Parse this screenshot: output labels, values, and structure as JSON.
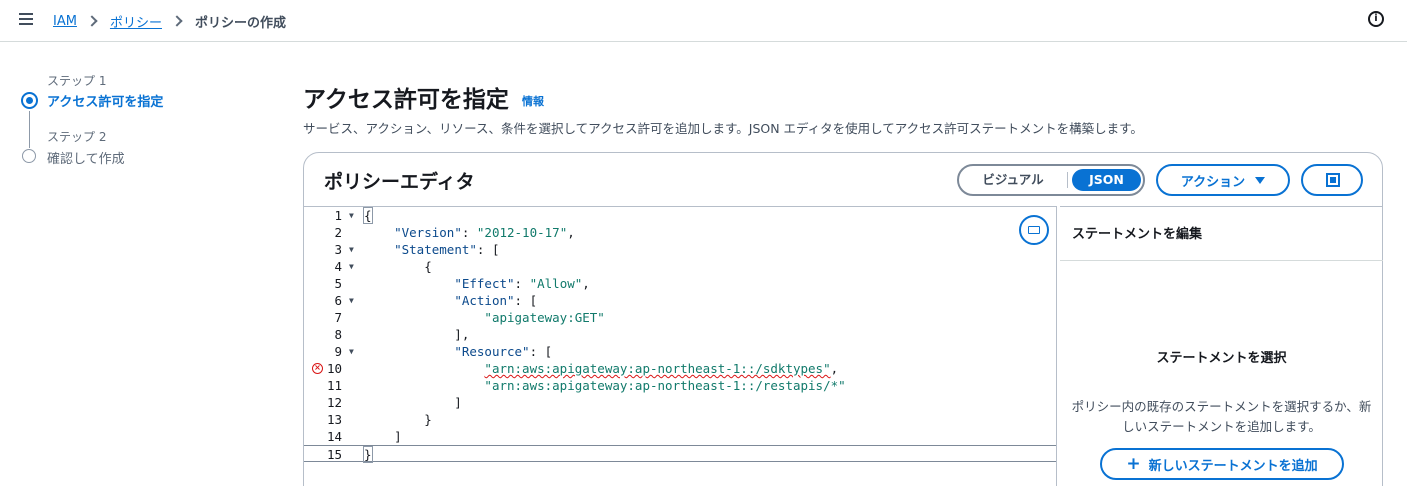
{
  "breadcrumb": {
    "items": [
      "IAM",
      "ポリシー"
    ],
    "current": "ポリシーの作成"
  },
  "steps": [
    {
      "label": "ステップ 1",
      "title": "アクセス許可を指定"
    },
    {
      "label": "ステップ 2",
      "title": "確認して作成"
    }
  ],
  "header": {
    "title": "アクセス許可を指定",
    "info_link": "情報",
    "description": "サービス、アクション、リソース、条件を選択してアクセス許可を追加します。JSON エディタを使用してアクセス許可ステートメントを構築します。"
  },
  "editor": {
    "title": "ポリシーエディタ",
    "toggle": {
      "visual": "ビジュアル",
      "json": "JSON",
      "selected": "JSON"
    },
    "actions_button": "アクション",
    "error_line": 10,
    "code_lines": [
      "{",
      "    \"Version\": \"2012-10-17\",",
      "    \"Statement\": [",
      "        {",
      "            \"Effect\": \"Allow\",",
      "            \"Action\": [",
      "                \"apigateway:GET\"",
      "            ],",
      "            \"Resource\": [",
      "                \"arn:aws:apigateway:ap-northeast-1::/sdktypes\",",
      "                \"arn:aws:apigateway:ap-northeast-1::/restapis/*\"",
      "            ]",
      "        }",
      "    ]",
      "}"
    ]
  },
  "side_panel": {
    "title": "ステートメントを編集",
    "empty_title": "ステートメントを選択",
    "empty_description": "ポリシー内の既存のステートメントを選択するか、新しいステートメントを追加します。",
    "add_button": "新しいステートメントを追加"
  },
  "colors": {
    "accent": "#0972d3",
    "error": "#d91515",
    "string": "#117a6b",
    "key": "#0c4a8c"
  },
  "icons": [
    "menu-icon",
    "chevron-right-icon",
    "info-icon",
    "caret-down-icon",
    "fullscreen-icon",
    "keyboard-icon",
    "error-icon",
    "plus-icon"
  ]
}
